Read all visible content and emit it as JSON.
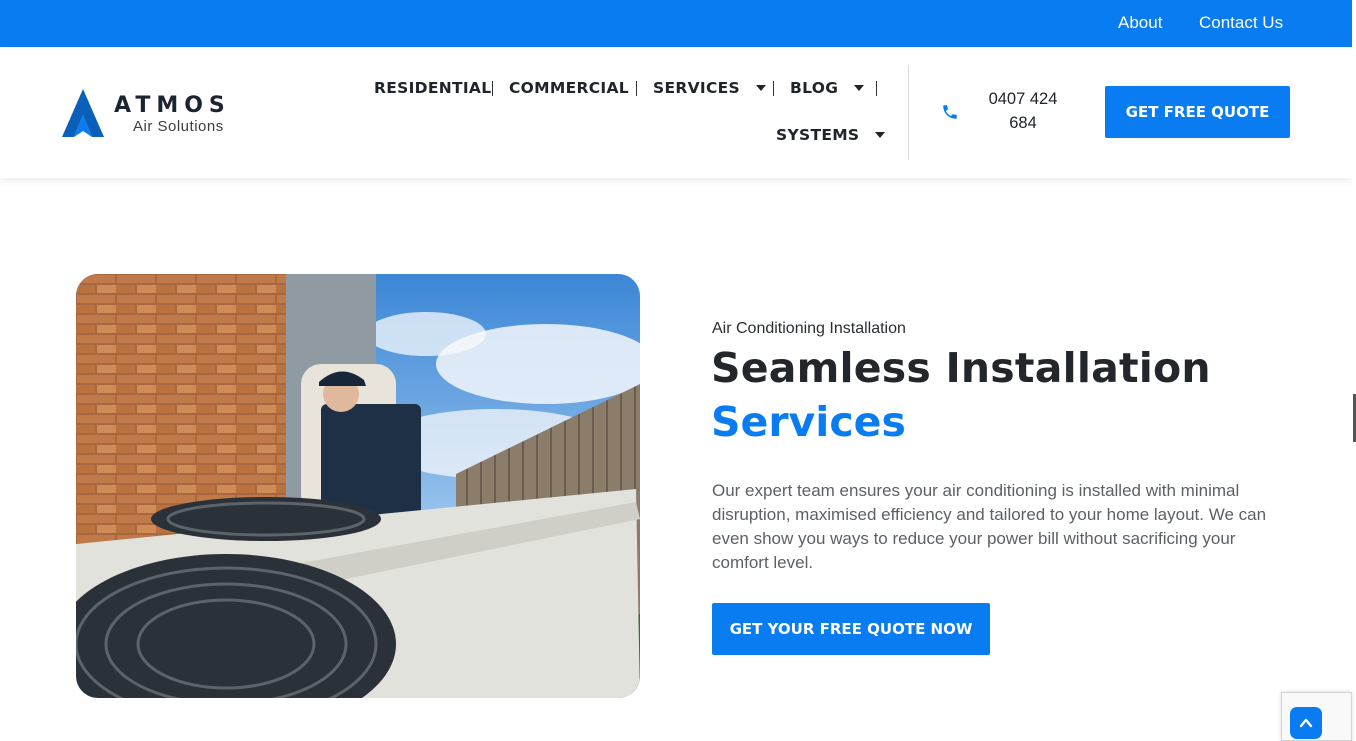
{
  "topbar": {
    "links": [
      "About",
      "Contact Us"
    ]
  },
  "brand": {
    "name": "ATMOS",
    "tagline": "Air Solutions"
  },
  "nav": {
    "items": [
      {
        "label": "RESIDENTIAL",
        "dropdown": false
      },
      {
        "label": "COMMERCIAL",
        "dropdown": false
      },
      {
        "label": "SERVICES",
        "dropdown": true
      },
      {
        "label": "BLOG",
        "dropdown": true
      },
      {
        "label": "SYSTEMS",
        "dropdown": true
      }
    ]
  },
  "contact": {
    "phone_line1": "0407 424",
    "phone_line2": "684",
    "icon": "phone-icon"
  },
  "header_cta": "GET FREE QUOTE",
  "hero": {
    "eyebrow": "Air Conditioning Installation",
    "title_line1": "Seamless Installation",
    "title_line2": "Services",
    "description": "Our expert team ensures your air conditioning is installed with minimal disruption, maximised efficiency and tailored to your home layout. We can even show you ways to reduce your power bill without sacrificing your comfort level.",
    "cta": "GET YOUR FREE QUOTE NOW",
    "image_alt": "Technician installing an outdoor air conditioning unit"
  },
  "colors": {
    "primary": "#0a7cf2",
    "heading": "#23262b",
    "body_text": "#5c6166"
  }
}
